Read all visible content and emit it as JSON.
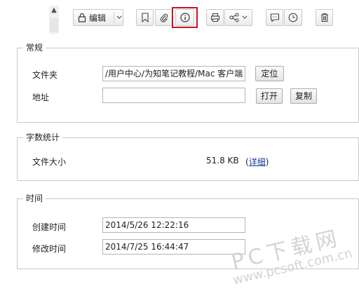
{
  "toolbar": {
    "edit_label": "编辑"
  },
  "sections": {
    "general": {
      "title": "常规",
      "folder_label": "文件夹",
      "folder_value": "/用户中心/为知笔记教程/Mac 客户端",
      "locate_label": "定位",
      "address_label": "地址",
      "address_value": "",
      "open_label": "打开",
      "copy_label": "复制"
    },
    "word_count": {
      "title": "字数统计",
      "size_label": "文件大小",
      "size_value": "51.8 KB",
      "details_paren_open": "(",
      "details_label": "详细",
      "details_paren_close": ")"
    },
    "time": {
      "title": "时间",
      "created_label": "创建时间",
      "created_value": "2014/5/26 12:22:16",
      "modified_label": "修改时间",
      "modified_value": "2014/7/25 16:44:47"
    }
  },
  "watermark": {
    "line1": "PC下载网",
    "line2": "www.pcsoft.com.cn"
  }
}
